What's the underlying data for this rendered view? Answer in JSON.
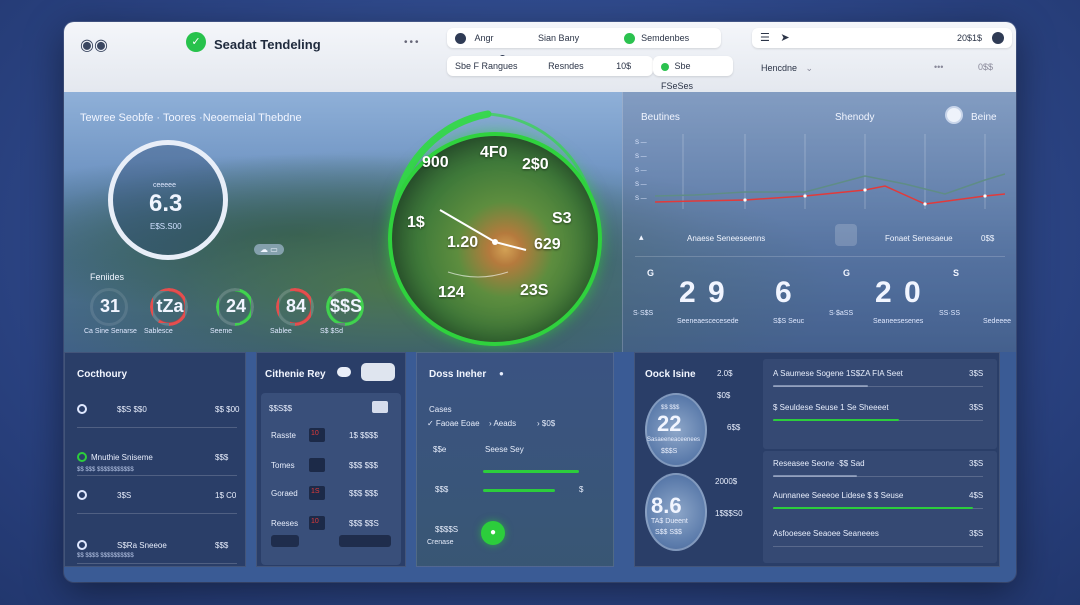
{
  "header": {
    "logo": "◉◉",
    "brand_mark": "✓",
    "title": "Seadat Tendeling",
    "dots": "•••",
    "pills_row1": [
      "Angr",
      "Sian Bany",
      "Semdenbes"
    ],
    "pills_row2": [
      "Sbe F Rangues",
      "Resndes",
      "10$",
      "Sbe FSeSes"
    ],
    "right_top": "20$1$",
    "right_row2": "Hencdne",
    "right_row2_value": "0$$"
  },
  "hero": {
    "heading": "Tewree Seobfe · Toores ·Neoemeial Thebdne",
    "big_gauge": {
      "label": "ceeeee",
      "value": "6.3",
      "sub": "E$S.S00"
    },
    "cloud_label": "☁ ▭",
    "mini_title": "Feniides",
    "mini_gauges": [
      {
        "value": "31",
        "label": "Ca Sine Senarse",
        "color": "#ffffff",
        "level": 0.0
      },
      {
        "value": "tZa",
        "label": "Sablesce",
        "color": "#e23a3a",
        "level": 0.6
      },
      {
        "value": "24",
        "label": "Seeme",
        "color": "#2ccd3c",
        "level": 0.45
      },
      {
        "value": "84",
        "label": "Sablee",
        "color": "#e23a3a",
        "level": 0.55
      },
      {
        "value": "$$S",
        "label": "S$ $Sd",
        "color": "#2ccd3c",
        "level": 0.85
      }
    ],
    "dial": {
      "numbers": [
        "900",
        "4F0",
        "2$0",
        "1$",
        "1.20",
        "≈",
        "629",
        "124",
        "23S",
        "S3"
      ]
    }
  },
  "right_hero": {
    "left_title": "Beutines",
    "center_title": "Shenody",
    "right_title": "Beine",
    "chart_y_labels": [
      "S —",
      "S —",
      "S —",
      "S —",
      "S —"
    ],
    "legend1": "Anaese Seneeseenns",
    "legend2": "Fonaet Senesaeue",
    "legend2_value": "0$$",
    "stats": [
      {
        "icon": "G",
        "value": "2 9",
        "label": "Seeneaescecesede",
        "caption": "S·S$S"
      },
      {
        "icon": "",
        "value": "6",
        "label": "S$S Seuc",
        "caption": ""
      },
      {
        "icon": "G",
        "value": "2 0",
        "label": "Seaneesesenes",
        "caption": "S·$aSS"
      },
      {
        "icon": "S",
        "value": "",
        "label": "Sedeeee",
        "caption": "SS·SS"
      }
    ]
  },
  "panel1": {
    "title": "Cocthoury",
    "rows": [
      {
        "label": "$$S $$0",
        "value": "$$ $00"
      },
      {
        "label": "Mnuthie Sniseme",
        "value": "$$$"
      },
      {
        "label": "3$S",
        "value": "1$ C0"
      },
      {
        "label": "S$Ra Sneeoe",
        "value": "$$$"
      }
    ],
    "sub_rows": [
      "$$ $$$ $$$$$$$$$$$",
      "$$ $$$$ $$$$$$$$$$"
    ]
  },
  "panel2": {
    "title": "Cithenie Rey",
    "chip": "$$S$$",
    "rows": [
      {
        "label": "Rasste",
        "code": "10",
        "value": "1$ $$$$"
      },
      {
        "label": "Tomes",
        "code": "",
        "value": "$$$ $$$"
      },
      {
        "label": "Goraed",
        "code": "1S",
        "value": "$$$ $$$"
      },
      {
        "label": "Reeses",
        "code": "10",
        "value": "$$$ $$S"
      }
    ]
  },
  "panel3": {
    "title": "Doss Ineher",
    "subtitle": "Cases",
    "filters": [
      "✓ Faoae Eoae",
      "› Aeads",
      "› $0$"
    ],
    "rows": [
      {
        "label": "$$e",
        "value": "Seese Sey"
      },
      {
        "label": "",
        "value": ""
      },
      {
        "label": "$$$",
        "value": "$"
      }
    ],
    "bottom_value": "$$$$S",
    "bottom_label": "Crenase"
  },
  "panel4": {
    "title": "Oock Isine",
    "circle1": {
      "value": "22",
      "top": "$$ $$$",
      "sub": "Sasaeeneaceenees",
      "caption": "$$$S"
    },
    "circle2": {
      "value": "8.6",
      "top": "",
      "sub": "TA$ Dueent",
      "caption": "S$$ S$$"
    },
    "mid_values": [
      "2.0$",
      "$0$",
      "6$$",
      "2000$",
      "1$$$S0"
    ],
    "rows": [
      {
        "label": "A Saumese Sogene 1S$ZA FIA Seet",
        "value": "3$S"
      },
      {
        "label": "$ Seuldese Seuse 1 Se Sheeeet",
        "value": "3$S"
      },
      {
        "label": "Reseasee Seone ·$$ Sad",
        "value": "3$S"
      },
      {
        "label": "Aunnanee Seeeoe Lidese $ $ Seuse",
        "value": "4$S"
      },
      {
        "label": "Asfooesee Seaoee Seaneees",
        "value": "3$S"
      }
    ]
  },
  "colors": {
    "accent_green": "#2ccd3c",
    "accent_red": "#e23a3a",
    "panel": "#2a3c63"
  }
}
